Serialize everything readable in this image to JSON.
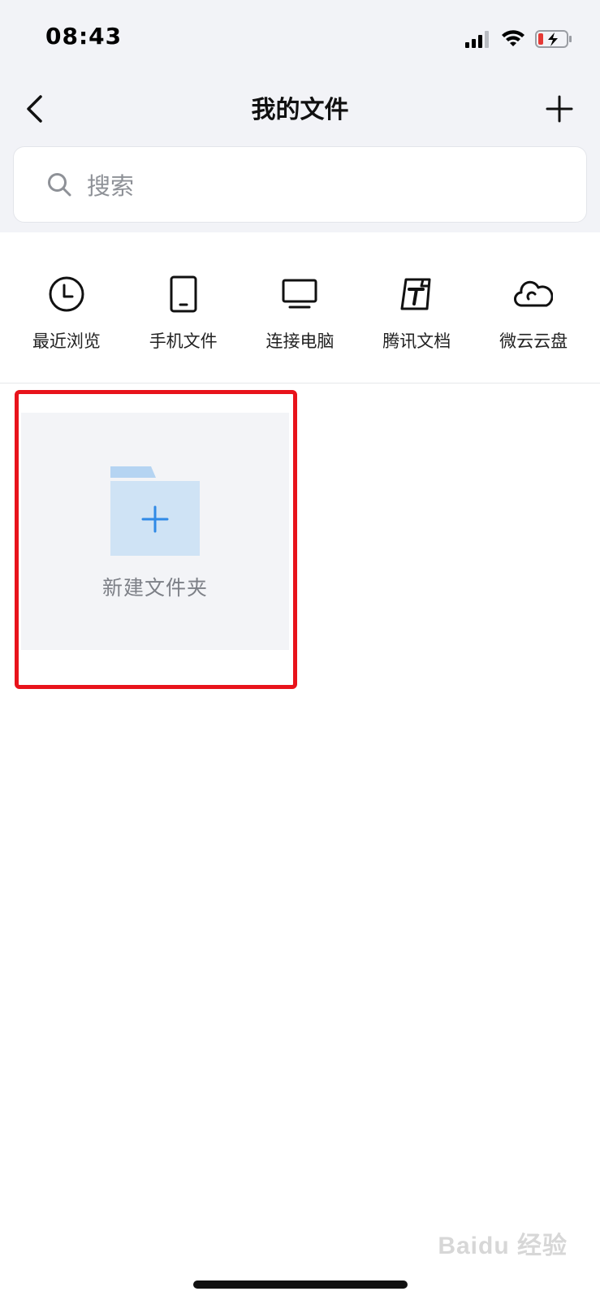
{
  "status_bar": {
    "time": "08:43",
    "icons": [
      "signal-icon",
      "wifi-icon",
      "battery-charging-icon"
    ]
  },
  "nav": {
    "title": "我的文件",
    "back_icon": "chevron-left-icon",
    "add_icon": "plus-icon"
  },
  "search": {
    "placeholder": "搜索",
    "icon": "search-icon"
  },
  "quick_access": [
    {
      "label": "最近浏览",
      "icon": "clock-icon"
    },
    {
      "label": "手机文件",
      "icon": "phone-icon"
    },
    {
      "label": "连接电脑",
      "icon": "monitor-icon"
    },
    {
      "label": "腾讯文档",
      "icon": "tencent-docs-icon"
    },
    {
      "label": "微云云盘",
      "icon": "cloud-icon"
    }
  ],
  "new_folder": {
    "label": "新建文件夹",
    "icon": "folder-plus-icon"
  },
  "colors": {
    "top_background": "#f2f3f7",
    "folder_light": "#cfe3f5",
    "folder_tab": "#b5d4f2",
    "plus_blue": "#2f8ae6",
    "highlight_red": "#e8131b"
  },
  "watermark": "Baidu 经验"
}
